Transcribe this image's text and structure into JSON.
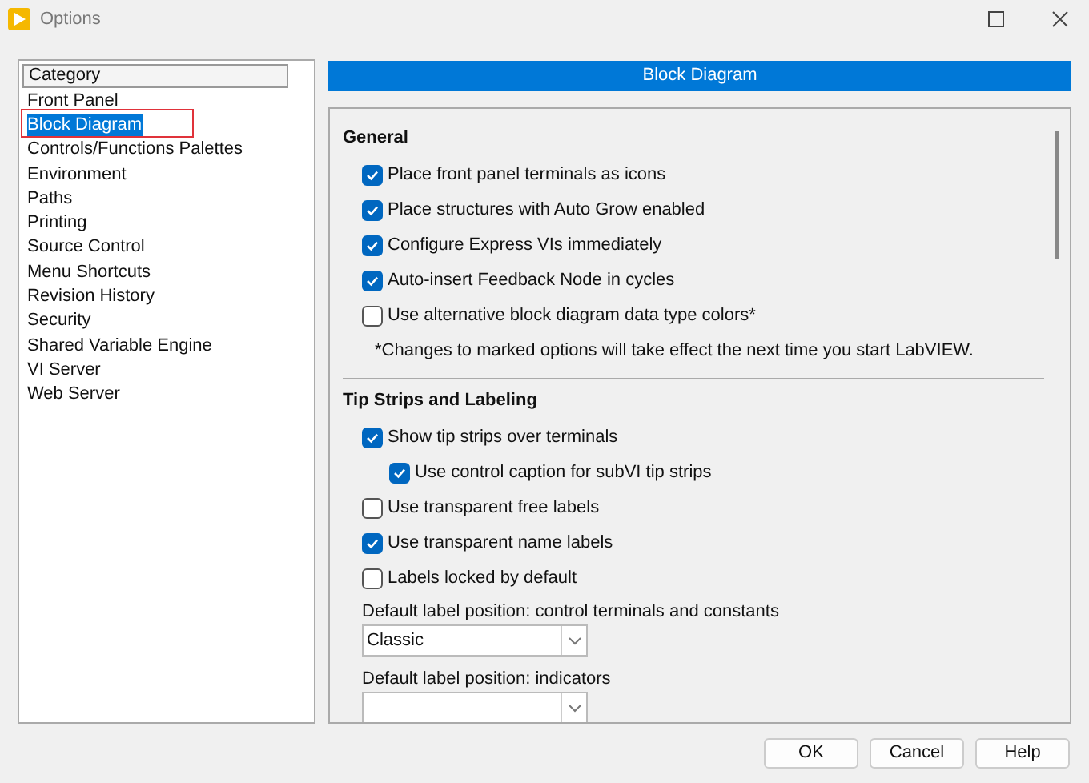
{
  "window": {
    "title": "Options"
  },
  "sidebar": {
    "header": "Category",
    "items": [
      {
        "label": "Front Panel",
        "selected": false
      },
      {
        "label": "Block Diagram",
        "selected": true
      },
      {
        "label": "Controls/Functions Palettes",
        "selected": false
      },
      {
        "label": "Environment",
        "selected": false
      },
      {
        "label": "Paths",
        "selected": false
      },
      {
        "label": "Printing",
        "selected": false
      },
      {
        "label": "Source Control",
        "selected": false
      },
      {
        "label": "Menu Shortcuts",
        "selected": false
      },
      {
        "label": "Revision History",
        "selected": false
      },
      {
        "label": "Security",
        "selected": false
      },
      {
        "label": "Shared Variable Engine",
        "selected": false
      },
      {
        "label": "VI Server",
        "selected": false
      },
      {
        "label": "Web Server",
        "selected": false
      }
    ]
  },
  "panel": {
    "title": "Block Diagram",
    "sections": [
      {
        "title": "General",
        "items": [
          {
            "kind": "checkbox",
            "label": "Place front panel terminals as icons",
            "checked": true
          },
          {
            "kind": "checkbox",
            "label": "Place structures with Auto Grow enabled",
            "checked": true
          },
          {
            "kind": "checkbox",
            "label": "Configure Express VIs immediately",
            "checked": true
          },
          {
            "kind": "checkbox",
            "label": "Auto-insert Feedback Node in cycles",
            "checked": true
          },
          {
            "kind": "checkbox",
            "label": "Use alternative block diagram data type colors*",
            "checked": false
          },
          {
            "kind": "note",
            "label": "*Changes to marked options will take effect the next time you start LabVIEW."
          }
        ]
      },
      {
        "title": "Tip Strips and Labeling",
        "items": [
          {
            "kind": "checkbox",
            "label": "Show tip strips over terminals",
            "checked": true,
            "children": [
              {
                "kind": "checkbox",
                "label": "Use control caption for subVI tip strips",
                "checked": true
              }
            ]
          },
          {
            "kind": "checkbox",
            "label": "Use transparent free labels",
            "checked": false
          },
          {
            "kind": "checkbox",
            "label": "Use transparent name labels",
            "checked": true
          },
          {
            "kind": "checkbox",
            "label": "Labels locked by default",
            "checked": false
          },
          {
            "kind": "dropdown",
            "label": "Default label position: control terminals and constants",
            "value": "Classic"
          },
          {
            "kind": "dropdown",
            "label": "Default label position: indicators"
          }
        ]
      }
    ]
  },
  "buttons": [
    "OK",
    "Cancel",
    "Help"
  ]
}
